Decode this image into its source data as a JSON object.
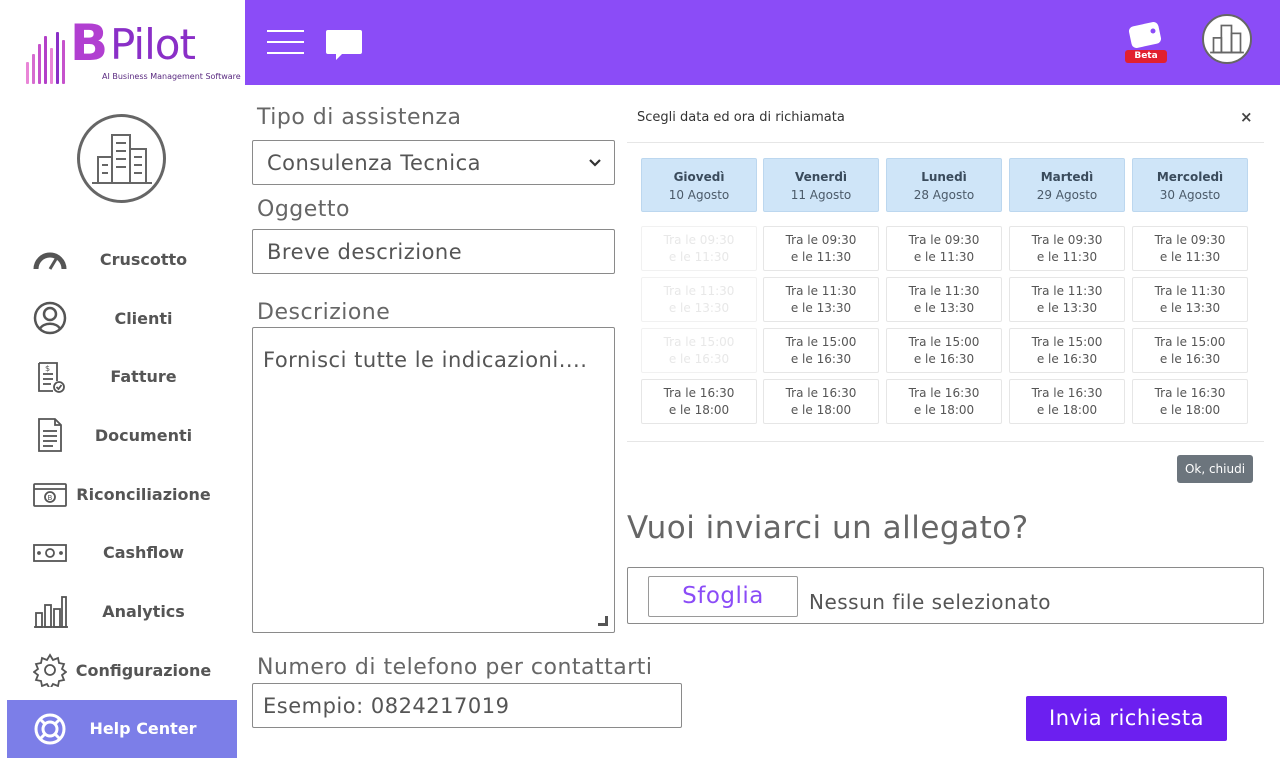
{
  "app": {
    "brand_b": "B",
    "brand_pilot": "Pilot",
    "tagline": "AI Business Management Software",
    "beta_badge": "Beta"
  },
  "sidebar": {
    "items": [
      {
        "label": "Cruscotto",
        "icon": "gauge-icon"
      },
      {
        "label": "Clienti",
        "icon": "user-circle-icon"
      },
      {
        "label": "Fatture",
        "icon": "invoice-icon"
      },
      {
        "label": "Documenti",
        "icon": "document-icon"
      },
      {
        "label": "Riconciliazione",
        "icon": "bank-reconcile-icon"
      },
      {
        "label": "Cashflow",
        "icon": "cash-icon"
      },
      {
        "label": "Analytics",
        "icon": "bar-chart-icon"
      },
      {
        "label": "Configurazione",
        "icon": "gear-icon"
      },
      {
        "label": "Help Center",
        "icon": "lifebuoy-icon",
        "active": true
      }
    ]
  },
  "form": {
    "assistance_type_label": "Tipo di assistenza",
    "assistance_type_value": "Consulenza Tecnica",
    "subject_label": "Oggetto",
    "subject_placeholder": "Breve descrizione",
    "description_label": "Descrizione",
    "description_placeholder": "Fornisci tutte le indicazioni....",
    "phone_label": "Numero di telefono per contattarti",
    "phone_placeholder": "Esempio: 0824217019",
    "submit_label": "Invia richiesta"
  },
  "callback": {
    "title": "Scegli data ed ora di richiamata",
    "close": "×",
    "ok_label": "Ok, chiudi",
    "days": [
      {
        "name": "Giovedì",
        "date": "10 Agosto"
      },
      {
        "name": "Venerdì",
        "date": "11 Agosto"
      },
      {
        "name": "Lunedì",
        "date": "28 Agosto"
      },
      {
        "name": "Martedì",
        "date": "29 Agosto"
      },
      {
        "name": "Mercoledì",
        "date": "30 Agosto"
      }
    ],
    "slots": [
      {
        "line1": "Tra le 09:30",
        "line2": "e le 11:30"
      },
      {
        "line1": "Tra le 11:30",
        "line2": "e le 13:30"
      },
      {
        "line1": "Tra le 15:00",
        "line2": "e le 16:30"
      },
      {
        "line1": "Tra le 16:30",
        "line2": "e le 18:00"
      }
    ],
    "disabled_slots_first_day": [
      0,
      1,
      2
    ]
  },
  "attachment": {
    "title": "Vuoi inviarci un allegato?",
    "browse_label": "Sfoglia",
    "no_file": "Nessun file selezionato"
  },
  "colors": {
    "header": "#8b4cf7",
    "active_nav": "#7c7ee8",
    "submit": "#6c1ff0",
    "day_header": "#cfe5f8"
  }
}
